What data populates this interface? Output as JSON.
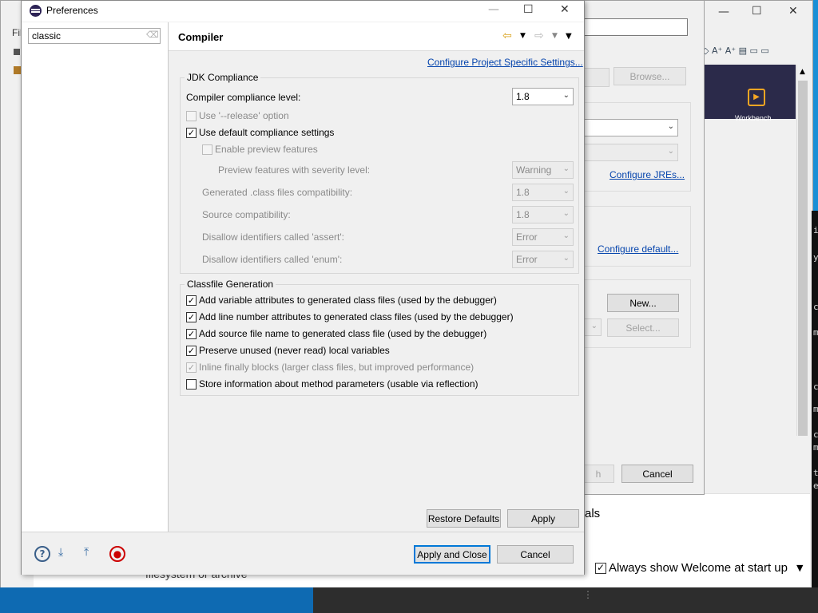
{
  "background": {
    "partial_menu": "Fil",
    "browse_label": "Browse...",
    "configure_jres": "Configure JREs...",
    "configure_default": "Configure default...",
    "new_label": "New...",
    "select_label": "Select...",
    "finish_partial": "h",
    "cancel_label": "Cancel",
    "welcome_tile": "Workbench",
    "tutorials_partial": "als",
    "always_show_welcome": "Always show Welcome at start up",
    "filesystem_text": "filesystem or archive",
    "terminal_chars": [
      "i",
      "y",
      "c",
      "m",
      "c",
      "m",
      "c",
      "m",
      "t",
      "e"
    ]
  },
  "dialog": {
    "title": "Preferences",
    "filter_value": "classic",
    "page_title": "Compiler",
    "project_settings_link": "Configure Project Specific Settings...",
    "jdk_group": {
      "label": "JDK Compliance",
      "compliance_label": "Compiler compliance level:",
      "compliance_value": "1.8",
      "release_option": "Use '--release' option",
      "default_settings": "Use default compliance settings",
      "preview_features": "Enable preview features",
      "preview_severity_label": "Preview features with severity level:",
      "preview_severity_value": "Warning",
      "class_compat_label": "Generated .class files compatibility:",
      "class_compat_value": "1.8",
      "source_compat_label": "Source compatibility:",
      "source_compat_value": "1.8",
      "assert_label": "Disallow identifiers called 'assert':",
      "assert_value": "Error",
      "enum_label": "Disallow identifiers called 'enum':",
      "enum_value": "Error"
    },
    "classfile_group": {
      "label": "Classfile Generation",
      "options": [
        "Add variable attributes to generated class files (used by the debugger)",
        "Add line number attributes to generated class files (used by the debugger)",
        "Add source file name to generated class file (used by the debugger)",
        "Preserve unused (never read) local variables",
        "Inline finally blocks (larger class files, but improved performance)",
        "Store information about method parameters (usable via reflection)"
      ]
    },
    "restore_defaults": "Restore Defaults",
    "apply": "Apply",
    "apply_and_close": "Apply and Close",
    "cancel": "Cancel"
  },
  "colors": {
    "accent": "#0078d7",
    "link": "#0645ad",
    "desktop": "#1a8fd6"
  }
}
